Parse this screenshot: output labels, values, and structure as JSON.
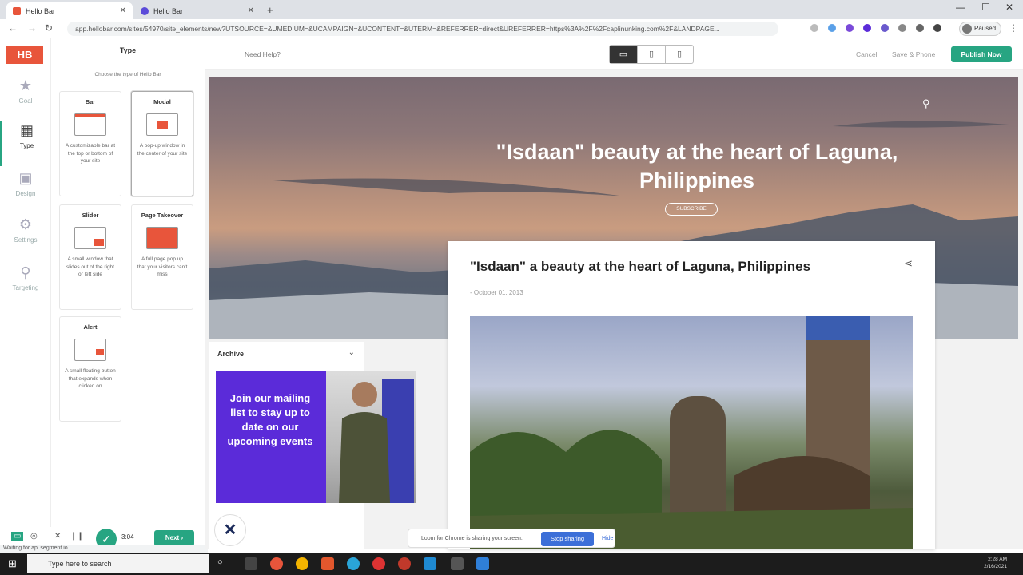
{
  "browser": {
    "tabs": [
      {
        "title": "Hello Bar",
        "active": true,
        "color": "#e8553b"
      },
      {
        "title": "Hello Bar",
        "active": false,
        "color": "#5b4bd9"
      }
    ],
    "new_tab": "+",
    "url": "app.hellobar.com/sites/54970/site_elements/new?UTSOURCE=&UMEDIUM=&UCAMPAIGN=&UCONTENT=&UTERM=&REFERRER=direct&UREFERRER=https%3A%2F%2Fcaplinunking.com%2F&LANDPAGE...",
    "profile_label": "Paused"
  },
  "rail": {
    "logo": "HB",
    "items": [
      {
        "label": "Goal",
        "icon": "star-icon"
      },
      {
        "label": "Type",
        "icon": "layout-icon"
      },
      {
        "label": "Design",
        "icon": "design-icon"
      },
      {
        "label": "Settings",
        "icon": "settings-icon"
      },
      {
        "label": "Targeting",
        "icon": "target-icon"
      }
    ]
  },
  "panel": {
    "title": "Type",
    "subtitle": "Choose the type of Hello Bar",
    "cards": [
      {
        "title": "Bar",
        "desc": "A customizable bar at the top or bottom of your site"
      },
      {
        "title": "Modal",
        "desc": "A pop-up window in the center of your site"
      },
      {
        "title": "Slider",
        "desc": "A small window that slides out of the right or left side"
      },
      {
        "title": "Page Takeover",
        "desc": "A full page pop up that your visitors can't miss"
      },
      {
        "title": "Alert",
        "desc": "A small floating button that expands when clicked on"
      }
    ],
    "next_label": "Next",
    "timer": "3:04"
  },
  "status_text": "Waiting for api.segment.io...",
  "topbar": {
    "help": "Need Help?",
    "devices": [
      "desktop-icon",
      "tablet-icon",
      "mobile-icon"
    ],
    "cancel": "Cancel",
    "save": "Save & Phone",
    "publish": "Publish Now"
  },
  "preview": {
    "hero_title": "\"Isdaan\" beauty at the heart of Laguna, Philippines",
    "subscribe": "SUBSCRIBE",
    "archive": "Archive",
    "popup_text": "Join our mailing list to stay up to date on our upcoming events",
    "post_title": "\"Isdaan\" a beauty at the heart of Laguna, Philippines",
    "post_date": "- October 01, 2013"
  },
  "loom": {
    "message": "Loom for Chrome is sharing your screen.",
    "stop": "Stop sharing",
    "hide": "Hide"
  },
  "taskbar": {
    "search_placeholder": "Type here to search",
    "time": "2:28 AM",
    "date": "2/16/2021"
  }
}
